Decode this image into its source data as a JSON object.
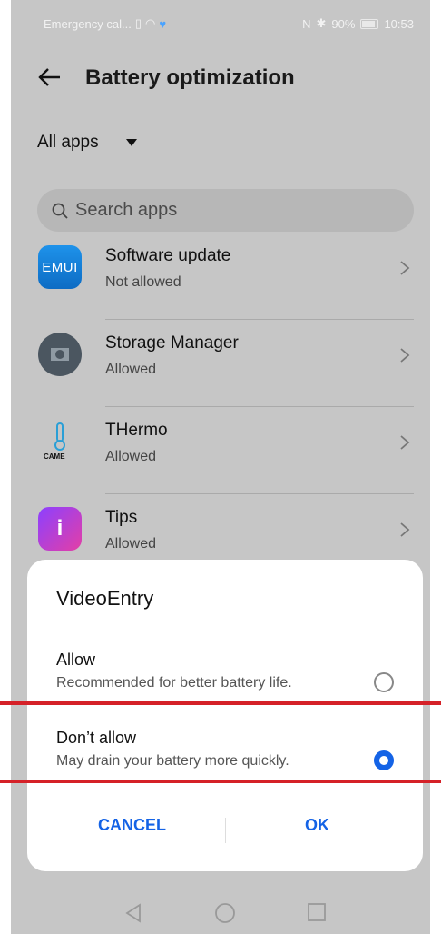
{
  "status_bar": {
    "left_text": "Emergency cal...",
    "battery": "90%",
    "time": "10:53"
  },
  "header": {
    "title": "Battery optimization",
    "back_icon": "arrow-left-icon"
  },
  "filter": {
    "label": "All apps"
  },
  "search": {
    "placeholder": "Search apps"
  },
  "apps": [
    {
      "name": "Software update",
      "status": "Not allowed",
      "icon_text": "EMUI"
    },
    {
      "name": "Storage Manager",
      "status": "Allowed",
      "icon_text": ""
    },
    {
      "name": "THermo",
      "status": "Allowed",
      "icon_text": "CAME"
    },
    {
      "name": "Tips",
      "status": "Allowed",
      "icon_text": "i"
    }
  ],
  "dialog": {
    "title": "VideoEntry",
    "options": [
      {
        "label": "Allow",
        "description": "Recommended for better battery life.",
        "selected": false
      },
      {
        "label": "Don’t allow",
        "description": "May drain your battery more quickly.",
        "selected": true
      }
    ],
    "cancel_label": "CANCEL",
    "ok_label": "OK"
  },
  "colors": {
    "accent": "#1463e6",
    "highlight": "#d52128",
    "dim_background": "#c6c6c6"
  }
}
